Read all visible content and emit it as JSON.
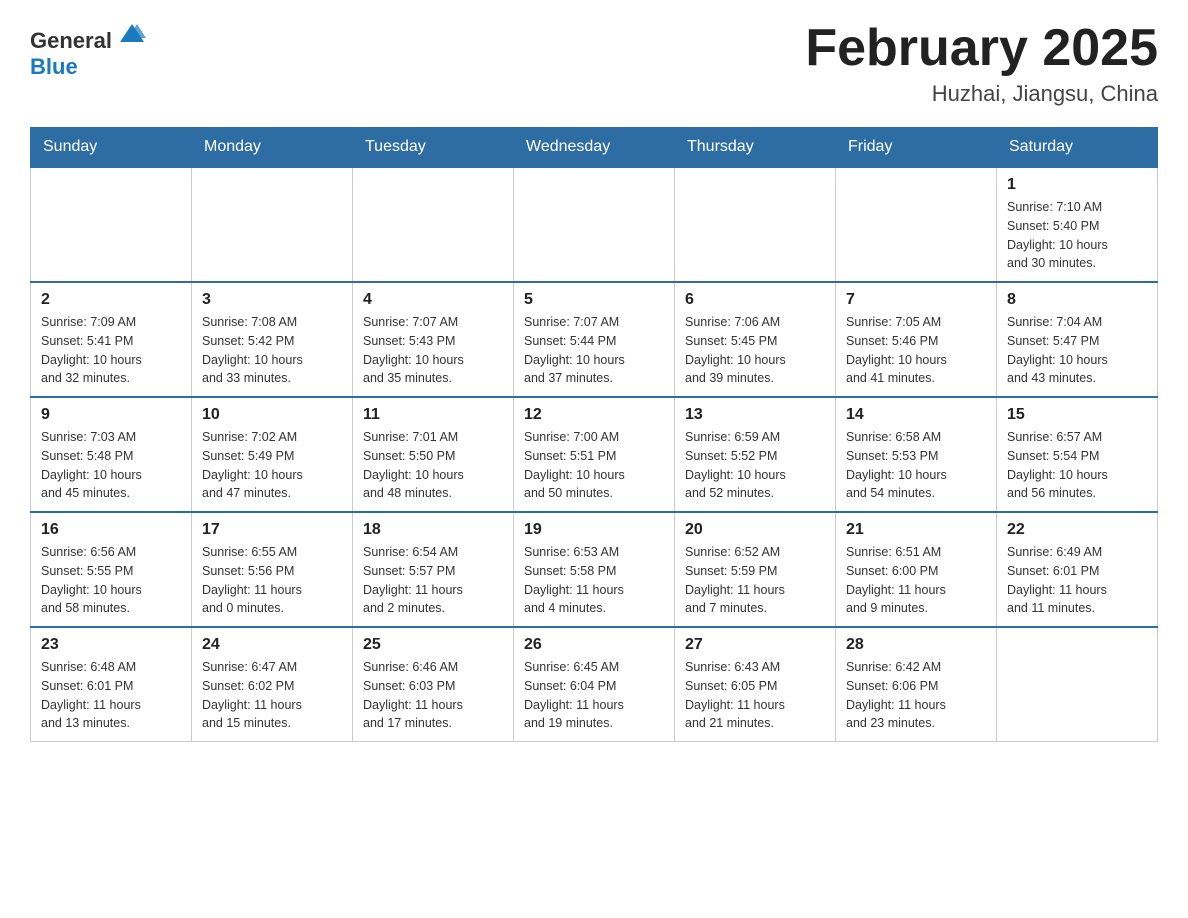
{
  "header": {
    "logo_general": "General",
    "logo_blue": "Blue",
    "month": "February 2025",
    "location": "Huzhai, Jiangsu, China"
  },
  "weekdays": [
    "Sunday",
    "Monday",
    "Tuesday",
    "Wednesday",
    "Thursday",
    "Friday",
    "Saturday"
  ],
  "weeks": [
    [
      {
        "day": "",
        "info": ""
      },
      {
        "day": "",
        "info": ""
      },
      {
        "day": "",
        "info": ""
      },
      {
        "day": "",
        "info": ""
      },
      {
        "day": "",
        "info": ""
      },
      {
        "day": "",
        "info": ""
      },
      {
        "day": "1",
        "info": "Sunrise: 7:10 AM\nSunset: 5:40 PM\nDaylight: 10 hours\nand 30 minutes."
      }
    ],
    [
      {
        "day": "2",
        "info": "Sunrise: 7:09 AM\nSunset: 5:41 PM\nDaylight: 10 hours\nand 32 minutes."
      },
      {
        "day": "3",
        "info": "Sunrise: 7:08 AM\nSunset: 5:42 PM\nDaylight: 10 hours\nand 33 minutes."
      },
      {
        "day": "4",
        "info": "Sunrise: 7:07 AM\nSunset: 5:43 PM\nDaylight: 10 hours\nand 35 minutes."
      },
      {
        "day": "5",
        "info": "Sunrise: 7:07 AM\nSunset: 5:44 PM\nDaylight: 10 hours\nand 37 minutes."
      },
      {
        "day": "6",
        "info": "Sunrise: 7:06 AM\nSunset: 5:45 PM\nDaylight: 10 hours\nand 39 minutes."
      },
      {
        "day": "7",
        "info": "Sunrise: 7:05 AM\nSunset: 5:46 PM\nDaylight: 10 hours\nand 41 minutes."
      },
      {
        "day": "8",
        "info": "Sunrise: 7:04 AM\nSunset: 5:47 PM\nDaylight: 10 hours\nand 43 minutes."
      }
    ],
    [
      {
        "day": "9",
        "info": "Sunrise: 7:03 AM\nSunset: 5:48 PM\nDaylight: 10 hours\nand 45 minutes."
      },
      {
        "day": "10",
        "info": "Sunrise: 7:02 AM\nSunset: 5:49 PM\nDaylight: 10 hours\nand 47 minutes."
      },
      {
        "day": "11",
        "info": "Sunrise: 7:01 AM\nSunset: 5:50 PM\nDaylight: 10 hours\nand 48 minutes."
      },
      {
        "day": "12",
        "info": "Sunrise: 7:00 AM\nSunset: 5:51 PM\nDaylight: 10 hours\nand 50 minutes."
      },
      {
        "day": "13",
        "info": "Sunrise: 6:59 AM\nSunset: 5:52 PM\nDaylight: 10 hours\nand 52 minutes."
      },
      {
        "day": "14",
        "info": "Sunrise: 6:58 AM\nSunset: 5:53 PM\nDaylight: 10 hours\nand 54 minutes."
      },
      {
        "day": "15",
        "info": "Sunrise: 6:57 AM\nSunset: 5:54 PM\nDaylight: 10 hours\nand 56 minutes."
      }
    ],
    [
      {
        "day": "16",
        "info": "Sunrise: 6:56 AM\nSunset: 5:55 PM\nDaylight: 10 hours\nand 58 minutes."
      },
      {
        "day": "17",
        "info": "Sunrise: 6:55 AM\nSunset: 5:56 PM\nDaylight: 11 hours\nand 0 minutes."
      },
      {
        "day": "18",
        "info": "Sunrise: 6:54 AM\nSunset: 5:57 PM\nDaylight: 11 hours\nand 2 minutes."
      },
      {
        "day": "19",
        "info": "Sunrise: 6:53 AM\nSunset: 5:58 PM\nDaylight: 11 hours\nand 4 minutes."
      },
      {
        "day": "20",
        "info": "Sunrise: 6:52 AM\nSunset: 5:59 PM\nDaylight: 11 hours\nand 7 minutes."
      },
      {
        "day": "21",
        "info": "Sunrise: 6:51 AM\nSunset: 6:00 PM\nDaylight: 11 hours\nand 9 minutes."
      },
      {
        "day": "22",
        "info": "Sunrise: 6:49 AM\nSunset: 6:01 PM\nDaylight: 11 hours\nand 11 minutes."
      }
    ],
    [
      {
        "day": "23",
        "info": "Sunrise: 6:48 AM\nSunset: 6:01 PM\nDaylight: 11 hours\nand 13 minutes."
      },
      {
        "day": "24",
        "info": "Sunrise: 6:47 AM\nSunset: 6:02 PM\nDaylight: 11 hours\nand 15 minutes."
      },
      {
        "day": "25",
        "info": "Sunrise: 6:46 AM\nSunset: 6:03 PM\nDaylight: 11 hours\nand 17 minutes."
      },
      {
        "day": "26",
        "info": "Sunrise: 6:45 AM\nSunset: 6:04 PM\nDaylight: 11 hours\nand 19 minutes."
      },
      {
        "day": "27",
        "info": "Sunrise: 6:43 AM\nSunset: 6:05 PM\nDaylight: 11 hours\nand 21 minutes."
      },
      {
        "day": "28",
        "info": "Sunrise: 6:42 AM\nSunset: 6:06 PM\nDaylight: 11 hours\nand 23 minutes."
      },
      {
        "day": "",
        "info": ""
      }
    ]
  ]
}
